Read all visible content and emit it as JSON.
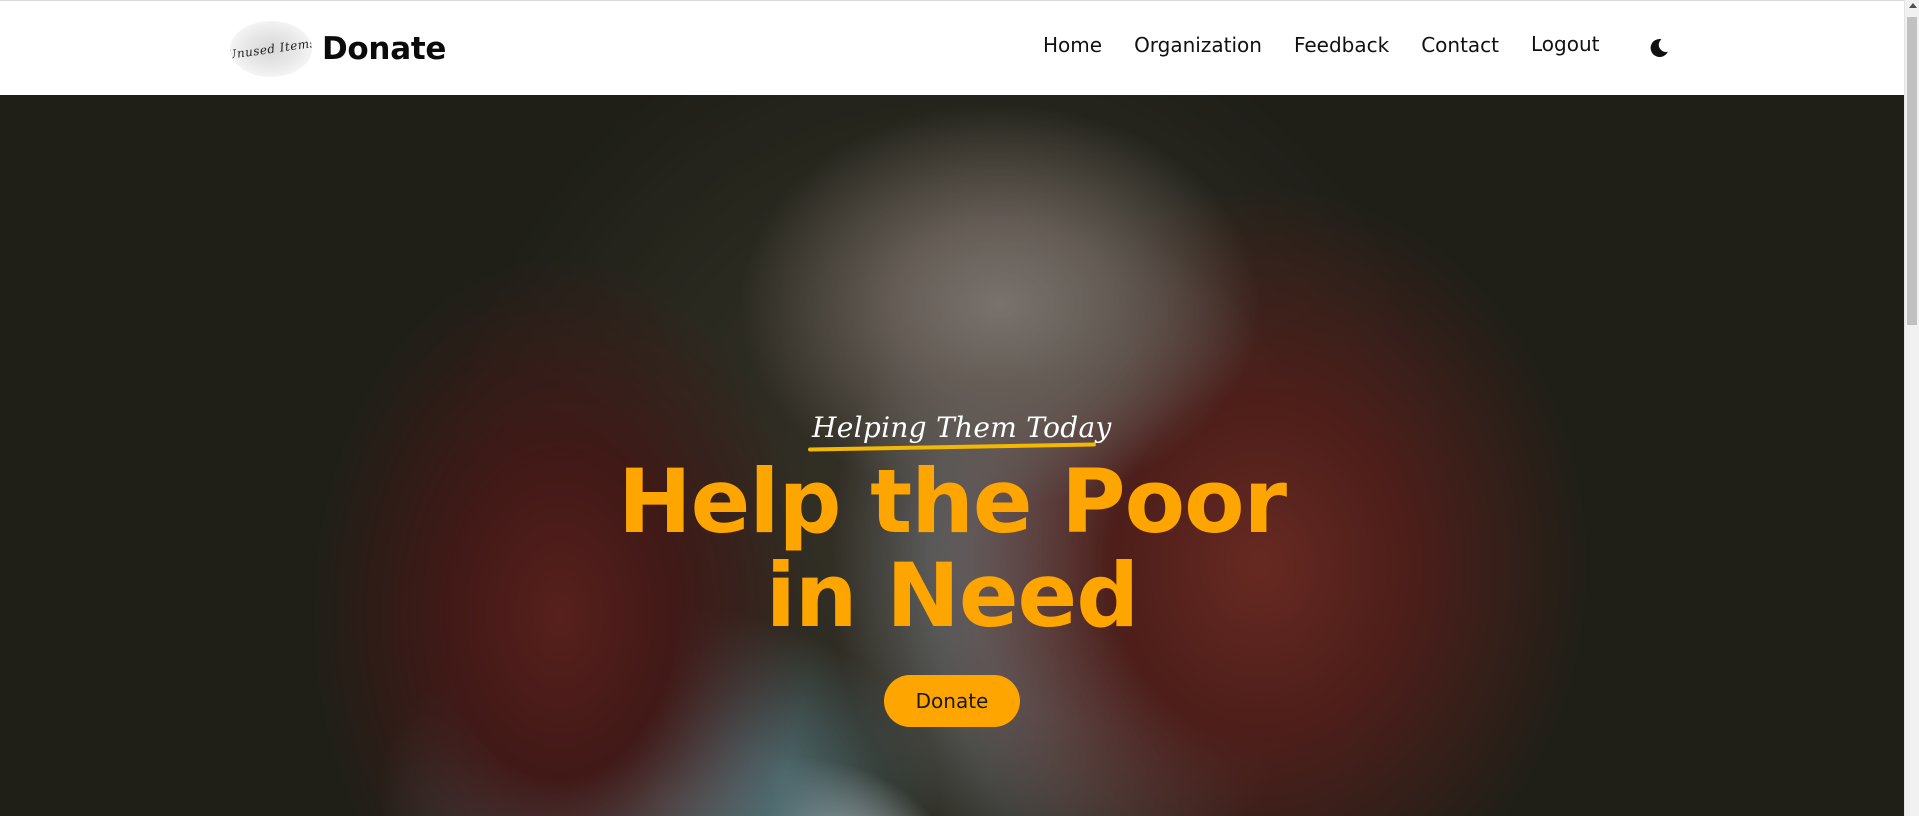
{
  "header": {
    "logo_text": "Unused Items",
    "brand": "Donate",
    "nav": [
      {
        "label": "Home"
      },
      {
        "label": "Organization"
      },
      {
        "label": "Feedback"
      },
      {
        "label": "Contact"
      },
      {
        "label": "Logout"
      }
    ],
    "theme_icon": "moon-icon"
  },
  "hero": {
    "tagline": "Helping Them Today",
    "headline": "Help the Poor in Need",
    "button_label": "Donate",
    "accent_color": "#ffa500",
    "underline_color": "#f5b800"
  }
}
